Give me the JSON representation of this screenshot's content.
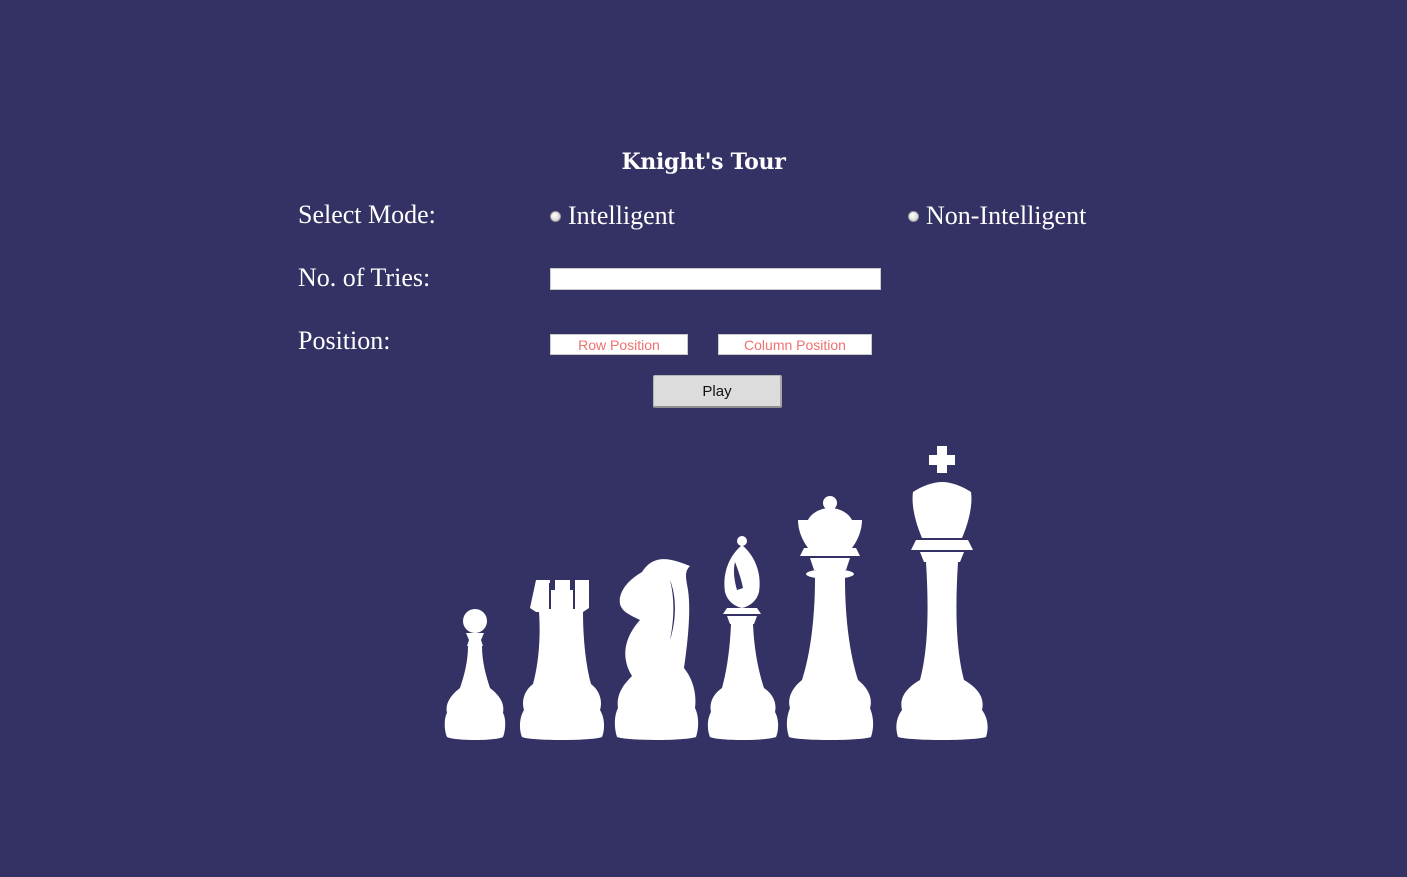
{
  "title": "Knight's Tour",
  "mode": {
    "label": "Select Mode:",
    "options": [
      {
        "label": "Intelligent",
        "selected": false
      },
      {
        "label": "Non-Intelligent",
        "selected": false
      }
    ]
  },
  "tries": {
    "label": "No. of Tries:",
    "value": "",
    "placeholder": ""
  },
  "position": {
    "label": "Position:",
    "row_placeholder": "Row Position",
    "column_placeholder": "Column Position"
  },
  "play_label": "Play",
  "pieces": [
    "pawn-icon",
    "rook-icon",
    "knight-icon",
    "bishop-icon",
    "queen-icon",
    "king-icon"
  ],
  "colors": {
    "background": "#343264",
    "text": "#ffffff",
    "placeholder": "#f07070",
    "button": "#dcdcdc"
  }
}
